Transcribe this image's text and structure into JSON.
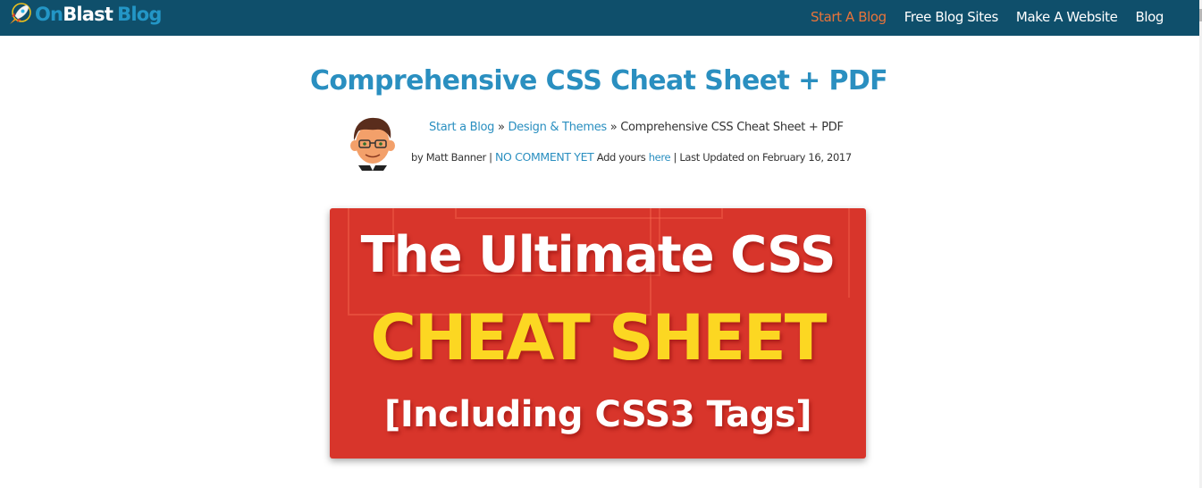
{
  "header": {
    "logo": {
      "icon": "rocket-icon",
      "part1": "On",
      "part2": "Blast",
      "part3": "Blog"
    },
    "nav": [
      {
        "label": "Start A Blog",
        "active": true
      },
      {
        "label": "Free Blog Sites",
        "active": false
      },
      {
        "label": "Make A Website",
        "active": false
      },
      {
        "label": "Blog",
        "active": false
      }
    ]
  },
  "article": {
    "title": "Comprehensive CSS Cheat Sheet + PDF",
    "breadcrumb": {
      "items": [
        "Start a Blog",
        "Design & Themes"
      ],
      "separator": "»",
      "current": "Comprehensive CSS Cheat Sheet + PDF"
    },
    "meta": {
      "by_label": "by",
      "author": "Matt Banner",
      "divider": "|",
      "comments": "NO COMMENT YET",
      "add_yours": "Add yours",
      "here_link": "here",
      "updated_label": "Last Updated on",
      "updated_date": "February 16, 2017"
    },
    "author_avatar": "author-cartoon-avatar",
    "hero_image": {
      "line1": "The Ultimate CSS",
      "line2": "CHEAT SHEET",
      "line3": "[Including CSS3 Tags]",
      "background": "#d8352b",
      "accent": "#fcd722"
    }
  },
  "colors": {
    "header_bg": "#0f4f6b",
    "link": "#2a8fc0",
    "nav_active": "#e8733a"
  }
}
